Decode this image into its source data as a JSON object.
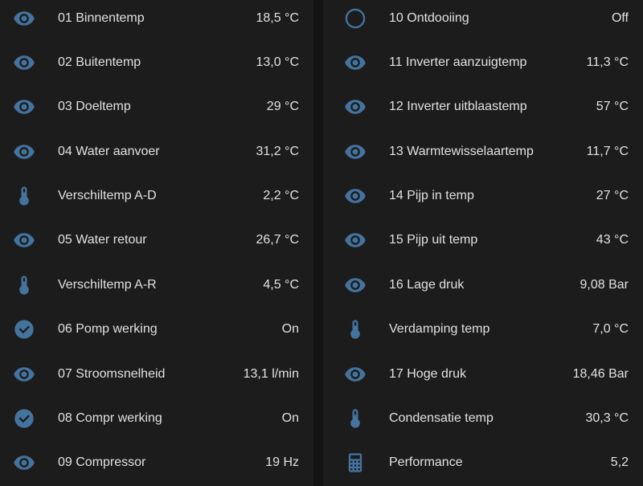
{
  "colors": {
    "background": "#131313",
    "card": "#1c1c1c",
    "text": "#e1e1e1",
    "icon": "#44739e"
  },
  "left_entities": [
    {
      "icon": "eye-icon",
      "name": "01 Binnentemp",
      "value": "18,5 °C"
    },
    {
      "icon": "eye-icon",
      "name": "02 Buitentemp",
      "value": "13,0 °C"
    },
    {
      "icon": "eye-icon",
      "name": "03 Doeltemp",
      "value": "29 °C"
    },
    {
      "icon": "eye-icon",
      "name": "04 Water aanvoer",
      "value": "31,2 °C"
    },
    {
      "icon": "thermometer-icon",
      "name": "Verschiltemp A-D",
      "value": "2,2 °C"
    },
    {
      "icon": "eye-icon",
      "name": "05 Water retour",
      "value": "26,7 °C"
    },
    {
      "icon": "thermometer-icon",
      "name": "Verschiltemp A-R",
      "value": "4,5 °C"
    },
    {
      "icon": "check-circle-icon",
      "name": "06 Pomp werking",
      "value": "On"
    },
    {
      "icon": "eye-icon",
      "name": "07 Stroomsnelheid",
      "value": "13,1 l/min"
    },
    {
      "icon": "check-circle-icon",
      "name": "08 Compr werking",
      "value": "On"
    },
    {
      "icon": "eye-icon",
      "name": "09 Compressor",
      "value": "19 Hz"
    }
  ],
  "right_entities": [
    {
      "icon": "circle-outline-icon",
      "name": "10 Ontdooiing",
      "value": "Off"
    },
    {
      "icon": "eye-icon",
      "name": "11 Inverter aanzuigtemp",
      "value": "11,3 °C"
    },
    {
      "icon": "eye-icon",
      "name": "12 Inverter uitblaastemp",
      "value": "57 °C"
    },
    {
      "icon": "eye-icon",
      "name": "13 Warmtewisselaartemp",
      "value": "11,7 °C"
    },
    {
      "icon": "eye-icon",
      "name": "14 Pijp in temp",
      "value": "27 °C"
    },
    {
      "icon": "eye-icon",
      "name": "15 Pijp uit temp",
      "value": "43 °C"
    },
    {
      "icon": "eye-icon",
      "name": "16 Lage druk",
      "value": "9,08 Bar"
    },
    {
      "icon": "thermometer-icon",
      "name": "Verdamping temp",
      "value": "7,0 °C"
    },
    {
      "icon": "eye-icon",
      "name": "17 Hoge druk",
      "value": "18,46 Bar"
    },
    {
      "icon": "thermometer-icon",
      "name": "Condensatie temp",
      "value": "30,3 °C"
    },
    {
      "icon": "calculator-icon",
      "name": "Performance",
      "value": "5,2"
    }
  ]
}
